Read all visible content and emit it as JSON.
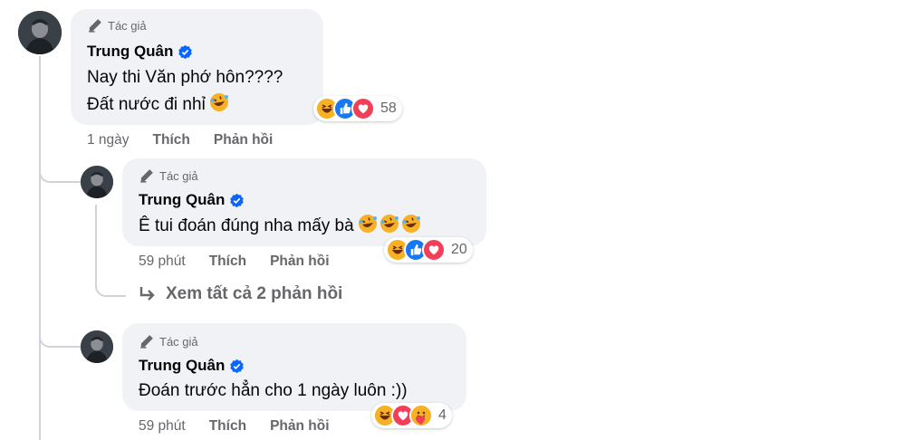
{
  "comments": [
    {
      "author_tag": "Tác giả",
      "author": "Trung Quân",
      "lines": [
        "Nay thi Văn phớ hôn????",
        "Đất nước đi nhỉ"
      ],
      "time": "1 ngày",
      "like": "Thích",
      "reply": "Phản hồi",
      "reactions": [
        "haha-icon",
        "like-icon",
        "love-icon"
      ],
      "reaction_count": "58"
    },
    {
      "author_tag": "Tác giả",
      "author": "Trung Quân",
      "lines": [
        "Ê tui đoán đúng nha mấy bà"
      ],
      "time": "59 phút",
      "like": "Thích",
      "reply": "Phản hồi",
      "reactions": [
        "haha-icon",
        "like-icon",
        "love-icon"
      ],
      "reaction_count": "20"
    },
    {
      "author_tag": "Tác giả",
      "author": "Trung Quân",
      "lines": [
        "Đoán trước hẳn cho 1 ngày luôn :))"
      ],
      "time": "59 phút",
      "like": "Thích",
      "reply": "Phản hồi",
      "reactions": [
        "haha-icon",
        "love-icon",
        "care-icon"
      ],
      "reaction_count": "4"
    }
  ],
  "see_all_replies": "Xem tất cả 2 phản hồi",
  "colors": {
    "bubble": "#f0f2f5",
    "verified": "#0866ff",
    "meta_text": "#65676b",
    "like": "#1877f2",
    "love": "#f33e58",
    "haha": "#f7b125"
  }
}
